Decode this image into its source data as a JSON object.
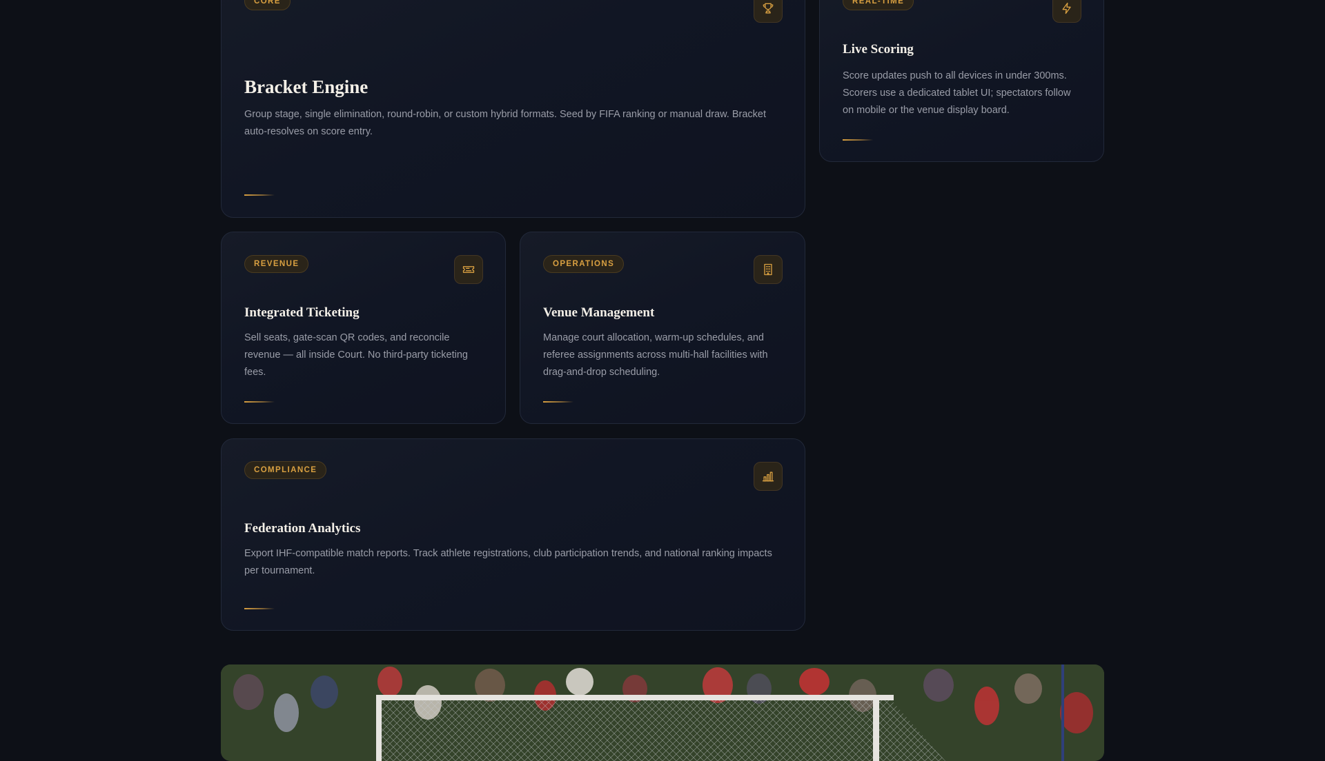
{
  "cards": {
    "bracket": {
      "badge": "CORE",
      "title": "Bracket Engine",
      "description": "Group stage, single elimination, round-robin, or custom hybrid formats. Seed by FIFA ranking or manual draw. Bracket auto-resolves on score entry.",
      "icon": "trophy-icon"
    },
    "live": {
      "badge": "REAL-TIME",
      "title": "Live Scoring",
      "description": "Score updates push to all devices in under 300ms. Scorers use a dedicated tablet UI; spectators follow on mobile or the venue display board.",
      "icon": "lightning-icon"
    },
    "ticketing": {
      "badge": "REVENUE",
      "title": "Integrated Ticketing",
      "description": "Sell seats, gate-scan QR codes, and reconcile revenue — all inside Court. No third-party ticketing fees.",
      "icon": "ticket-icon"
    },
    "venue": {
      "badge": "OPERATIONS",
      "title": "Venue Management",
      "description": "Manage court allocation, warm-up schedules, and referee assignments across multi-hall facilities with drag-and-drop scheduling.",
      "icon": "building-icon"
    },
    "analytics": {
      "badge": "COMPLIANCE",
      "title": "Federation Analytics",
      "description": "Export IHF-compatible match reports. Track athlete registrations, club participation trends, and national ranking impacts per tournament.",
      "icon": "bar-chart-icon"
    }
  },
  "colors": {
    "accent": "#d9a041",
    "background": "#0d1017",
    "card": "#131826"
  }
}
